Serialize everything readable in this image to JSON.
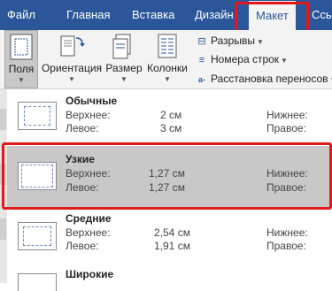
{
  "tabs": [
    {
      "label": "Файл",
      "active": false
    },
    {
      "label": "Главная",
      "active": false
    },
    {
      "label": "Вставка",
      "active": false
    },
    {
      "label": "Дизайн",
      "active": false
    },
    {
      "label": "Макет",
      "active": true
    },
    {
      "label": "Ссы",
      "active": false
    }
  ],
  "ribbon": {
    "fields_label": "Поля",
    "orientation_label": "Ориентация",
    "size_label": "Размер",
    "columns_label": "Колонки",
    "breaks_label": "Разрывы",
    "line_numbers_label": "Номера строк",
    "hyphenation_label": "Расстановка переносов"
  },
  "margins": [
    {
      "name": "Обычные",
      "top_label": "Верхнее:",
      "top": "2 см",
      "left_label": "Левое:",
      "left": "3 см",
      "bottom_label": "Нижнее:",
      "right_label": "Правое:",
      "selected": false
    },
    {
      "name": "Узкие",
      "top_label": "Верхнее:",
      "top": "1,27 см",
      "left_label": "Левое:",
      "left": "1,27 см",
      "bottom_label": "Нижнее:",
      "right_label": "Правое:",
      "selected": true
    },
    {
      "name": "Средние",
      "top_label": "Верхнее:",
      "top": "2,54 см",
      "left_label": "Левое:",
      "left": "1,91 см",
      "bottom_label": "Нижнее:",
      "right_label": "Правое:",
      "selected": false
    },
    {
      "name": "Широкие",
      "selected": false
    }
  ],
  "colors": {
    "accent": "#2b579a",
    "highlight": "#e0191b",
    "selected_bg": "#c8c8c8"
  }
}
